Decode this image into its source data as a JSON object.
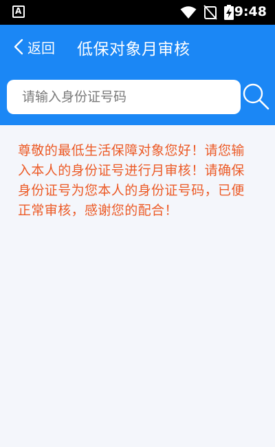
{
  "status_bar": {
    "time": "9:48",
    "app_icon_letter": "A",
    "icons": [
      "wifi-icon",
      "no-signal-icon",
      "battery-charging-icon"
    ]
  },
  "header": {
    "back_label": "返回",
    "title": "低保对象月审核"
  },
  "search": {
    "placeholder": "请输入身份证号码",
    "value": ""
  },
  "notice": {
    "text": "尊敬的最低生活保障对象您好！请您输入本人的身份证号进行月审核！请确保身份证号为您本人的身份证号码，已便正常审核，感谢您的配合！"
  },
  "colors": {
    "primary": "#1b87f5",
    "notice_text": "#ec5a26",
    "page_bg": "#f4f6fb"
  }
}
